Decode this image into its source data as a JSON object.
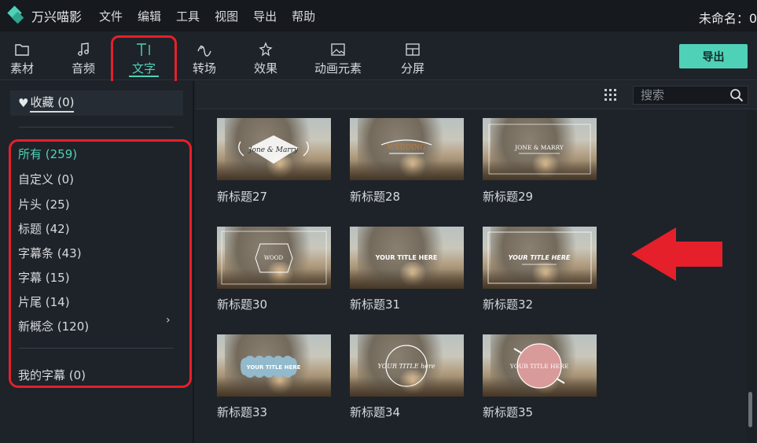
{
  "menubar": {
    "app_title": "万兴喵影",
    "items": [
      "文件",
      "编辑",
      "工具",
      "视图",
      "导出",
      "帮助"
    ],
    "project_title": "未命名：0"
  },
  "toolbar": {
    "tabs": [
      {
        "label": "素材",
        "icon": "folder-icon"
      },
      {
        "label": "音频",
        "icon": "music-note-icon"
      },
      {
        "label": "文字",
        "icon": "text-icon",
        "active": true
      },
      {
        "label": "转场",
        "icon": "transition-icon"
      },
      {
        "label": "效果",
        "icon": "effects-icon"
      },
      {
        "label": "动画元素",
        "icon": "image-icon"
      },
      {
        "label": "分屏",
        "icon": "split-screen-icon"
      }
    ],
    "export_label": "导出"
  },
  "sidebar": {
    "favorites": "收藏 (0)",
    "categories": [
      {
        "label": "所有 (259)",
        "active": true
      },
      {
        "label": "自定义 (0)"
      },
      {
        "label": "片头 (25)"
      },
      {
        "label": "标题 (42)"
      },
      {
        "label": "字幕条 (43)"
      },
      {
        "label": "字幕 (15)"
      },
      {
        "label": "片尾 (14)"
      },
      {
        "label": "新概念 (120)",
        "has_submenu": true
      }
    ],
    "my_subtitles": "我的字幕 (0)"
  },
  "content": {
    "search_placeholder": "搜索",
    "items": [
      {
        "label": "新标题27",
        "overlay": "Jone & Marry"
      },
      {
        "label": "新标题28",
        "overlay": "WEDDING"
      },
      {
        "label": "新标题29",
        "overlay": "JONE & MARRY"
      },
      {
        "label": "新标题30",
        "overlay": "WOOD"
      },
      {
        "label": "新标题31",
        "overlay": "YOUR TITLE HERE"
      },
      {
        "label": "新标题32",
        "overlay": "YOUR TITLE HERE"
      },
      {
        "label": "新标题33",
        "overlay": "YOUR TITLE HERE"
      },
      {
        "label": "新标题34",
        "overlay": "YOUR TITLE here"
      },
      {
        "label": "新标题35",
        "overlay": "YOUR TITLE HERE"
      }
    ]
  },
  "colors": {
    "accent": "#4fd1b8",
    "annotation_red": "#e5202a",
    "background": "#1e2329",
    "menubar": "#16191d"
  }
}
